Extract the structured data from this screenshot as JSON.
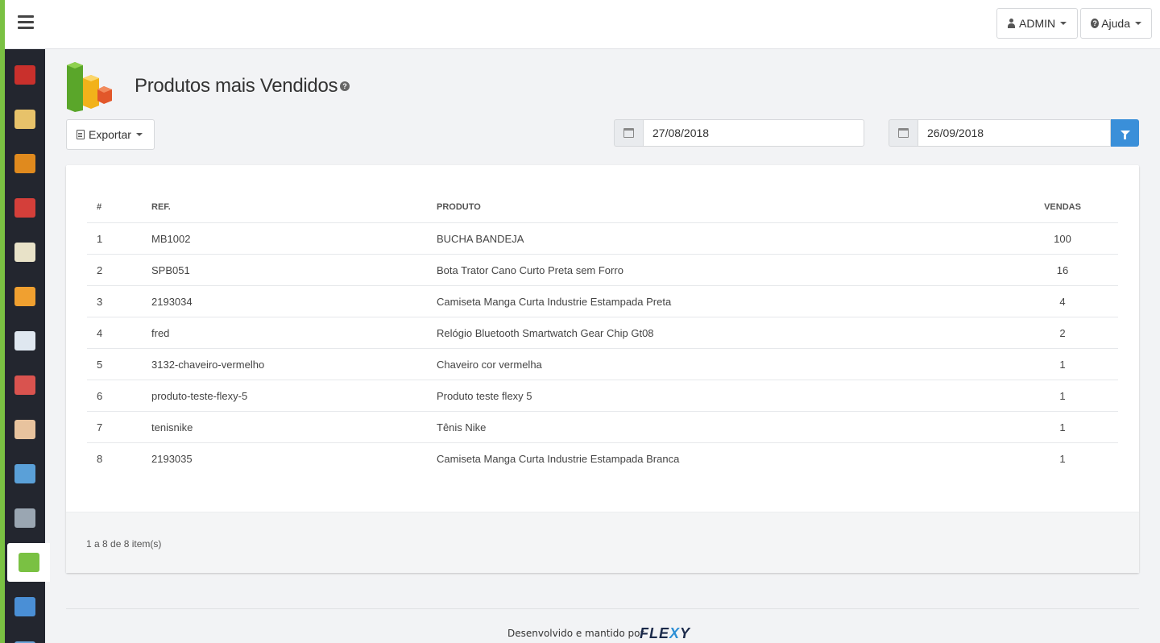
{
  "topbar": {
    "user_label": "ADMIN",
    "help_label": "Ajuda"
  },
  "sidebar": {
    "items": [
      {
        "icon": "box-icon",
        "color": "#c9302c"
      },
      {
        "icon": "catalog-icon",
        "color": "#e7c26a"
      },
      {
        "icon": "package-icon",
        "color": "#e08a1e"
      },
      {
        "icon": "discount-icon",
        "color": "#d43f3a"
      },
      {
        "icon": "card-icon",
        "color": "#e8e2c8"
      },
      {
        "icon": "truck-icon",
        "color": "#f0a030"
      },
      {
        "icon": "note-icon",
        "color": "#dfe7f0"
      },
      {
        "icon": "users-icon",
        "color": "#d9534f"
      },
      {
        "icon": "admin-user-icon",
        "color": "#e8c39e"
      },
      {
        "icon": "banner-icon",
        "color": "#5aa0d8"
      },
      {
        "icon": "database-icon",
        "color": "#9aa6b2"
      },
      {
        "icon": "bar-chart-icon",
        "color": "#7ac143",
        "active": true
      },
      {
        "icon": "monitor-icon",
        "color": "#4a8fd6"
      },
      {
        "icon": "settings-icon",
        "color": "#6aa3d8"
      }
    ]
  },
  "page": {
    "title": "Produtos mais Vendidos",
    "export_label": "Exportar",
    "date_from": "27/08/2018",
    "date_to": "26/09/2018"
  },
  "table": {
    "headers": {
      "num": "#",
      "ref": "REF.",
      "product": "PRODUTO",
      "sales": "VENDAS"
    },
    "rows": [
      {
        "num": "1",
        "ref": "MB1002",
        "product": "BUCHA BANDEJA",
        "sales": "100"
      },
      {
        "num": "2",
        "ref": "SPB051",
        "product": "Bota Trator Cano Curto Preta sem Forro",
        "sales": "16"
      },
      {
        "num": "3",
        "ref": "2193034",
        "product": "Camiseta Manga Curta Industrie Estampada Preta",
        "sales": "4"
      },
      {
        "num": "4",
        "ref": "fred",
        "product": "Relógio Bluetooth Smartwatch Gear Chip Gt08",
        "sales": "2"
      },
      {
        "num": "5",
        "ref": "3132-chaveiro-vermelho",
        "product": "Chaveiro cor vermelha",
        "sales": "1"
      },
      {
        "num": "6",
        "ref": "produto-teste-flexy-5",
        "product": "Produto teste flexy 5",
        "sales": "1"
      },
      {
        "num": "7",
        "ref": "tenisnike",
        "product": "Tênis Nike",
        "sales": "1"
      },
      {
        "num": "8",
        "ref": "2193035",
        "product": "Camiseta Manga Curta Industrie Estampada Branca",
        "sales": "1"
      }
    ],
    "pager_text": "1 a 8 de 8 item(s)"
  },
  "footer": {
    "text": "Desenvolvido e mantido por",
    "brand_a": "FLE",
    "brand_x": "X",
    "brand_b": "Y"
  }
}
